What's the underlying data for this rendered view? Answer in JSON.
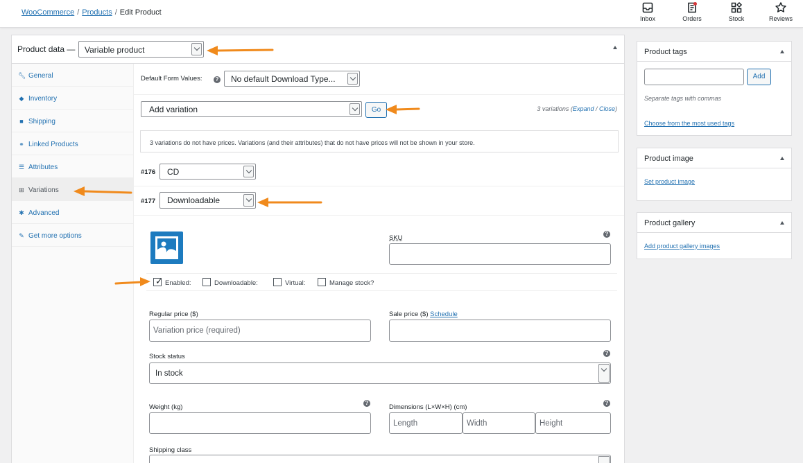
{
  "breadcrumb": {
    "items": [
      "WooCommerce",
      "Products"
    ],
    "current": "Edit Product",
    "separator": "/"
  },
  "topnav": [
    {
      "label": "Inbox",
      "icon": "inbox-icon"
    },
    {
      "label": "Orders",
      "icon": "orders-icon"
    },
    {
      "label": "Stock",
      "icon": "stock-icon"
    },
    {
      "label": "Reviews",
      "icon": "star-icon"
    }
  ],
  "product_data": {
    "label": "Product data —",
    "type_value": "Variable product",
    "tabs": [
      {
        "label": "General",
        "icon": "wrench-icon"
      },
      {
        "label": "Inventory",
        "icon": "tag-icon"
      },
      {
        "label": "Shipping",
        "icon": "truck-icon"
      },
      {
        "label": "Linked Products",
        "icon": "link-icon"
      },
      {
        "label": "Attributes",
        "icon": "list-icon"
      },
      {
        "label": "Variations",
        "icon": "grid-icon",
        "active": true
      },
      {
        "label": "Advanced",
        "icon": "gear-icon"
      },
      {
        "label": "Get more options",
        "icon": "plugin-icon"
      }
    ]
  },
  "variations": {
    "default_form_label": "Default Form Values:",
    "default_form_value": "No default Download Type...",
    "add_variation_value": "Add variation",
    "go_label": "Go",
    "count_text": "3 variations (",
    "expand_label": "Expand",
    "slash": " / ",
    "close_label": "Close",
    "close_paren": ")",
    "notice": "3 variations do not have prices. Variations (and their attributes) that do not have prices will not be shown in your store.",
    "items": [
      {
        "id": "#176",
        "value": "CD"
      },
      {
        "id": "#177",
        "value": "Downloadable"
      }
    ],
    "sku_label": "SKU",
    "checkboxes": [
      {
        "label": "Enabled:",
        "checked": true
      },
      {
        "label": "Downloadable:",
        "checked": false
      },
      {
        "label": "Virtual:",
        "checked": false
      },
      {
        "label": "Manage stock?",
        "checked": false
      }
    ],
    "regular_price_label": "Regular price ($)",
    "regular_price_placeholder": "Variation price (required)",
    "sale_price_label": "Sale price ($)",
    "schedule_label": "Schedule",
    "stock_status_label": "Stock status",
    "stock_status_value": "In stock",
    "weight_label": "Weight (kg)",
    "dimensions_label": "Dimensions (L×W×H) (cm)",
    "length_placeholder": "Length",
    "width_placeholder": "Width",
    "height_placeholder": "Height",
    "shipping_class_label": "Shipping class"
  },
  "sidebar": {
    "tags": {
      "title": "Product tags",
      "add_label": "Add",
      "hint": "Separate tags with commas",
      "choose_link": "Choose from the most used tags"
    },
    "image": {
      "title": "Product image",
      "link": "Set product image"
    },
    "gallery": {
      "title": "Product gallery",
      "link": "Add product gallery images"
    }
  },
  "colors": {
    "accent": "#2271b1",
    "annotation_arrow": "#f08a1c",
    "image_placeholder": "#1d7bbf"
  }
}
